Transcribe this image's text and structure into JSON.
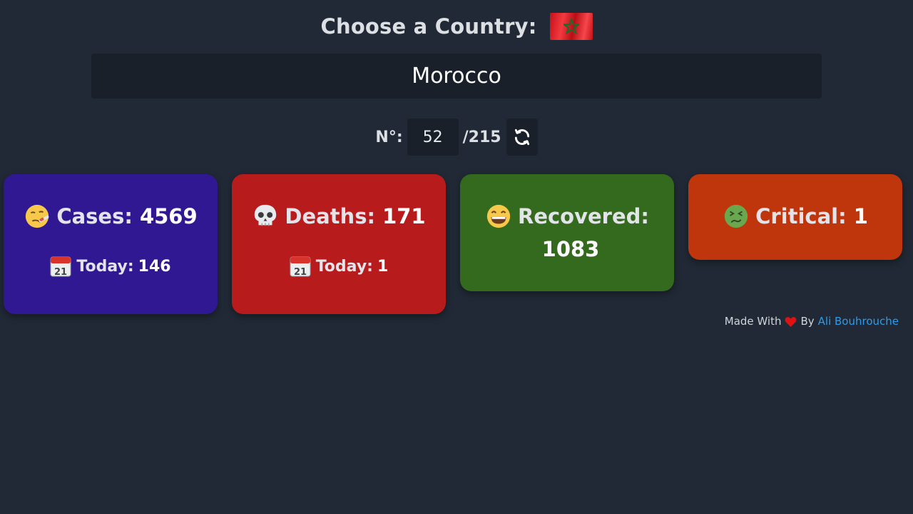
{
  "header": {
    "title": "Choose a Country:",
    "flag_icon": "morocco-flag-icon"
  },
  "country": {
    "value": "Morocco"
  },
  "navigator": {
    "label": "N°:",
    "index": "52",
    "total": "/215",
    "refresh_icon": "refresh-icon"
  },
  "cards": {
    "cases": {
      "label": "Cases:",
      "value": "4569",
      "today_label": "Today:",
      "today_value": "146",
      "icon": "sick-face-emoji-icon",
      "color": "#311893"
    },
    "deaths": {
      "label": "Deaths:",
      "value": "171",
      "today_label": "Today:",
      "today_value": "1",
      "icon": "skull-emoji-icon",
      "color": "#b71b1c"
    },
    "recovered": {
      "label": "Recovered:",
      "value": "1083",
      "icon": "grinning-face-emoji-icon",
      "color": "#336a1e"
    },
    "critical": {
      "label": "Critical:",
      "value": "1",
      "icon": "nauseated-face-emoji-icon",
      "color": "#bf360c"
    }
  },
  "footer": {
    "made_with": "Made With",
    "by": "By",
    "author": "Ali Bouhrouche",
    "author_color": "#2f9be8"
  }
}
